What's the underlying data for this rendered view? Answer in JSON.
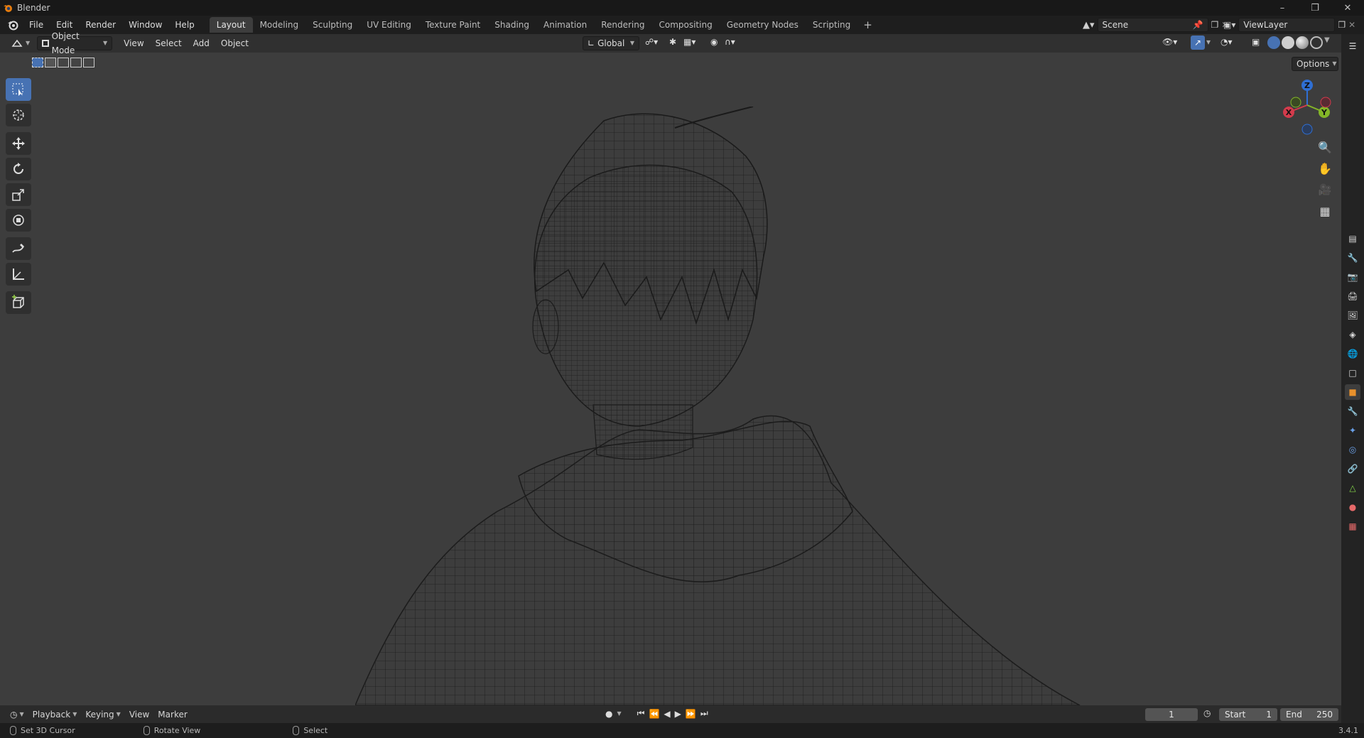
{
  "window": {
    "title": "Blender"
  },
  "menu": {
    "items": [
      "File",
      "Edit",
      "Render",
      "Window",
      "Help"
    ],
    "workspace_tabs": [
      {
        "label": "Layout",
        "active": true
      },
      {
        "label": "Modeling"
      },
      {
        "label": "Sculpting"
      },
      {
        "label": "UV Editing"
      },
      {
        "label": "Texture Paint"
      },
      {
        "label": "Shading"
      },
      {
        "label": "Animation"
      },
      {
        "label": "Rendering"
      },
      {
        "label": "Compositing"
      },
      {
        "label": "Geometry Nodes"
      },
      {
        "label": "Scripting"
      }
    ],
    "add_tab": "+",
    "scene": "Scene",
    "view_layer": "ViewLayer"
  },
  "viewport_header": {
    "mode": "Object Mode",
    "view": "View",
    "select": "Select",
    "add": "Add",
    "object": "Object",
    "transform_orientation": "Global",
    "options": "Options"
  },
  "timeline": {
    "playback": "Playback",
    "keying": "Keying",
    "view": "View",
    "marker": "Marker",
    "current_frame": "1",
    "start_label": "Start",
    "start_value": "1",
    "end_label": "End",
    "end_value": "250"
  },
  "status": {
    "left_click": "Set 3D Cursor",
    "middle_click": "Rotate View",
    "right_click": "Select",
    "version": "3.4.1"
  },
  "gizmo": {
    "z": "Z",
    "y": "Y",
    "x": "X"
  },
  "colors": {
    "accent": "#4772b3",
    "axis_x": "#d33b4c",
    "axis_y": "#84b628",
    "axis_z": "#2f6fd4"
  }
}
